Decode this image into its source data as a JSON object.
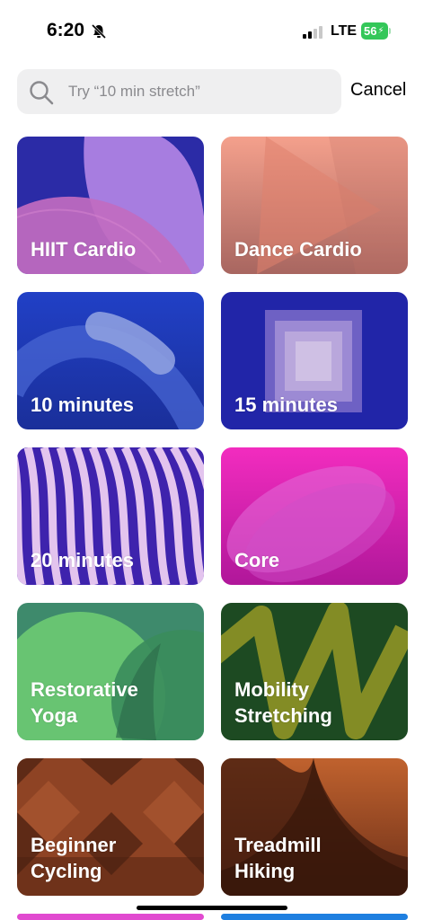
{
  "status_bar": {
    "time": "6:20",
    "network": "LTE",
    "battery": "56",
    "battery_color": "#34c759"
  },
  "search": {
    "placeholder": "Try “10 min stretch”",
    "cancel_label": "Cancel"
  },
  "tiles": [
    {
      "label": "HIIT Cardio",
      "icon": "abstract-petals",
      "colors": [
        "#2b2ba6",
        "#b47bd6"
      ]
    },
    {
      "label": "Dance Cardio",
      "icon": "abstract-triangle",
      "colors": [
        "#f0957e",
        "#b97068"
      ]
    },
    {
      "label": "10 minutes",
      "icon": "abstract-arc",
      "colors": [
        "#1f3bc0",
        "#8a99d8"
      ]
    },
    {
      "label": "15 minutes",
      "icon": "abstract-squares",
      "colors": [
        "#1f22a8",
        "#d6c2e6"
      ]
    },
    {
      "label": "20 minutes",
      "icon": "abstract-stripes",
      "colors": [
        "#3c1ea8",
        "#e6c2ec"
      ]
    },
    {
      "label": "Core",
      "icon": "abstract-ovals",
      "colors": [
        "#f02ab8",
        "#b81a9a"
      ]
    },
    {
      "label": "Restorative\nYoga",
      "icon": "abstract-circles",
      "colors": [
        "#3a8a6a",
        "#7ce07a"
      ]
    },
    {
      "label": "Mobility\nStretching",
      "icon": "abstract-zigzag",
      "colors": [
        "#1d4a22",
        "#a8a028"
      ]
    },
    {
      "label": "Beginner\nCycling",
      "icon": "abstract-diamonds",
      "colors": [
        "#8a3a1e",
        "#3a1a10"
      ]
    },
    {
      "label": "Treadmill\nHiking",
      "icon": "abstract-peak",
      "colors": [
        "#b85a2a",
        "#3a1a10"
      ]
    }
  ]
}
